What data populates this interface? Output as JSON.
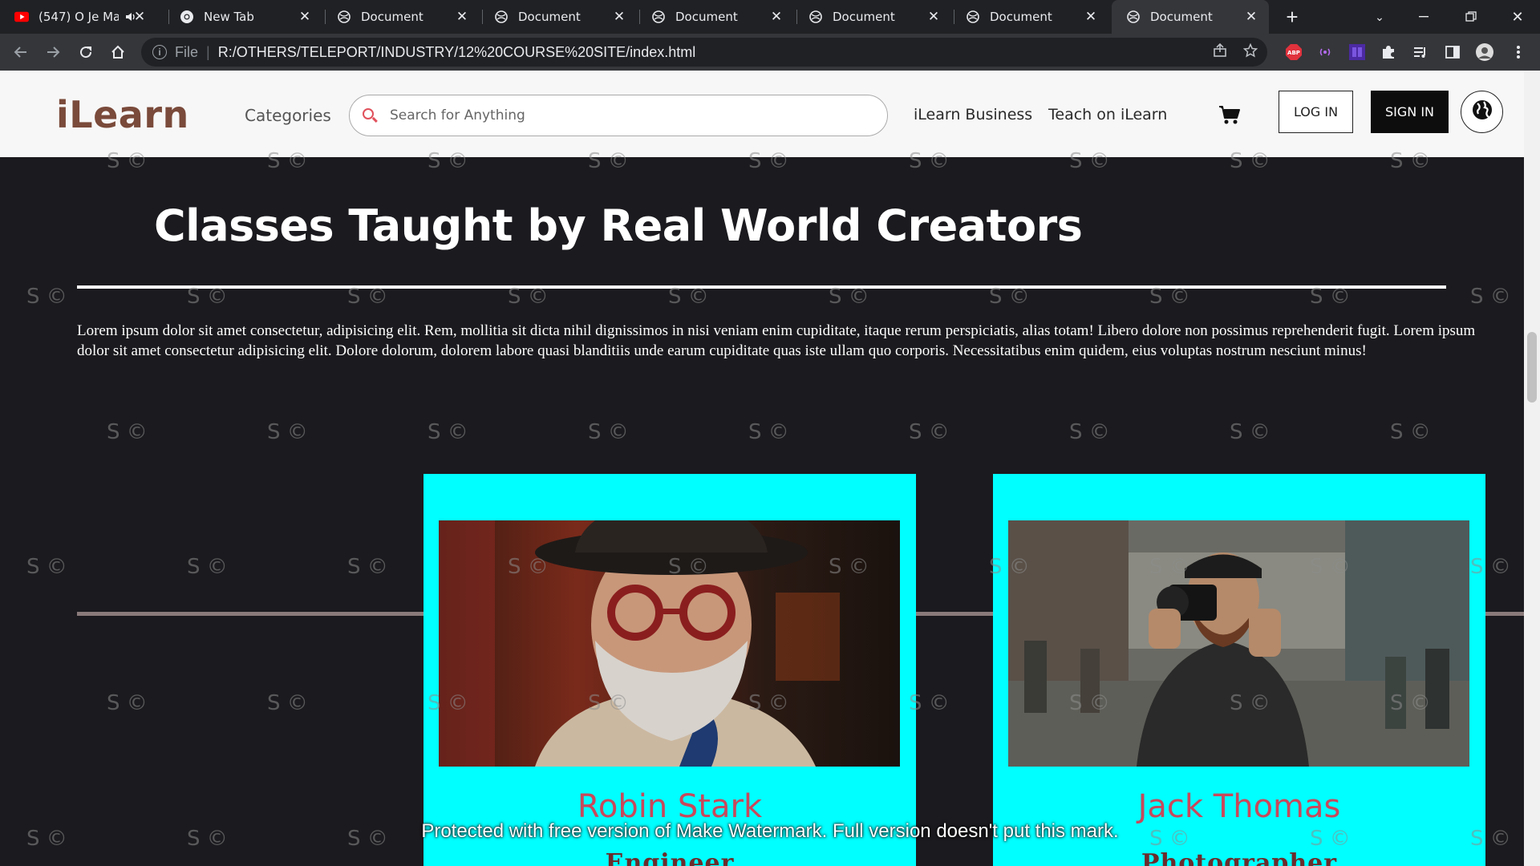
{
  "browser": {
    "tabs": [
      {
        "title": "(547) O Je Ma",
        "icon": "youtube-icon",
        "audio": true
      },
      {
        "title": "New Tab",
        "icon": "chrome-icon"
      },
      {
        "title": "Document",
        "icon": "globe-icon"
      },
      {
        "title": "Document",
        "icon": "globe-icon"
      },
      {
        "title": "Document",
        "icon": "globe-icon"
      },
      {
        "title": "Document",
        "icon": "globe-icon"
      },
      {
        "title": "Document",
        "icon": "globe-icon"
      },
      {
        "title": "Document",
        "icon": "globe-icon",
        "active": true
      }
    ],
    "omnibox": {
      "scheme_label": "File",
      "url": "R:/OTHERS/TELEPORT/INDUSTRY/12%20COURSE%20SITE/index.html"
    }
  },
  "header": {
    "logo": "iLearn",
    "categories": "Categories",
    "search_placeholder": "Search for Anything",
    "business_link": "iLearn Business",
    "teach_link": "Teach on iLearn",
    "login_label": "LOG IN",
    "signin_label": "SIGN IN"
  },
  "section": {
    "title": "Classes Taught by Real World Creators",
    "body": "Lorem ipsum dolor sit amet consectetur, adipisicing elit. Rem, mollitia sit dicta nihil dignissimos in nisi veniam enim cupiditate, itaque rerum perspiciatis, alias totam! Libero dolore non possimus reprehenderit fugit. Lorem ipsum dolor sit amet consectetur adipisicing elit. Dolore dolorum, dolorem labore quasi blanditiis unde earum cupiditate quas iste ullam quo corporis. Necessitatibus enim quidem, eius voluptas nostrum nesciunt minus!"
  },
  "instructors": [
    {
      "name": "Robin Stark",
      "role": "Engineer"
    },
    {
      "name": "Jack Thomas",
      "role": "Photographer"
    }
  ],
  "watermark": {
    "mark": "S ©",
    "banner": "Protected with free version of Make Watermark. Full version doesn't put this mark."
  },
  "colors": {
    "accent_cyan": "#00ffff",
    "name_color": "#c8485b",
    "logo_color": "#7a4a3a",
    "page_bg": "#1b1a1e"
  }
}
